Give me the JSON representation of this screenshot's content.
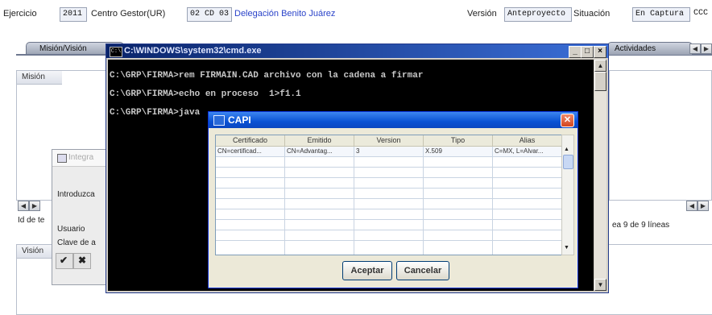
{
  "topbar": {
    "ejercicio_label": "Ejercicio",
    "ejercicio_value": "2011",
    "centro_label": "Centro Gestor(UR)",
    "centro_value": "02 CD 03",
    "centro_name": "Delegación Benito Juárez",
    "version_label": "Versión",
    "version_value": "Anteproyecto",
    "situacion_label": "Situación",
    "situacion_value": "En Captura",
    "cut_value": "CCC"
  },
  "background_app": {
    "tab_mision": "Misión/Visión",
    "tab_actividades": "Actividades",
    "mision_header": "Misión",
    "vision_header": "Visión",
    "id_label": "Id de te",
    "linea_text": "ea 9 de 9 líneas",
    "nav_left": "◀▶",
    "nav_right": "◀▶"
  },
  "login_fragment": {
    "title": "Integra",
    "introduzca": "Introduzca",
    "usuario": "Usuario",
    "clave": "Clave de a",
    "ok_icon": "check-icon",
    "cancel_icon": "x-icon"
  },
  "cmd_window": {
    "title": "C:\\WINDOWS\\system32\\cmd.exe",
    "icon_text": "C:\\",
    "lines": [
      "C:\\GRP\\FIRMA>rem FIRMAIN.CAD archivo con la cadena a firmar",
      "C:\\GRP\\FIRMA>echo en proceso  1>f1.1",
      "C:\\GRP\\FIRMA>java"
    ],
    "buttons": [
      "_",
      "□",
      "×"
    ]
  },
  "capi_dialog": {
    "title": "CAPI",
    "columns": [
      "Certificado",
      "Emitido",
      "Version",
      "Tipo",
      "Alias"
    ],
    "rows": [
      [
        "CN=certificad...",
        "CN=Advantag...",
        "3",
        "X.509",
        "C=MX, L=Alvar..."
      ]
    ],
    "empty_rows": 9,
    "accept_label": "Aceptar",
    "cancel_label": "Cancelar"
  }
}
